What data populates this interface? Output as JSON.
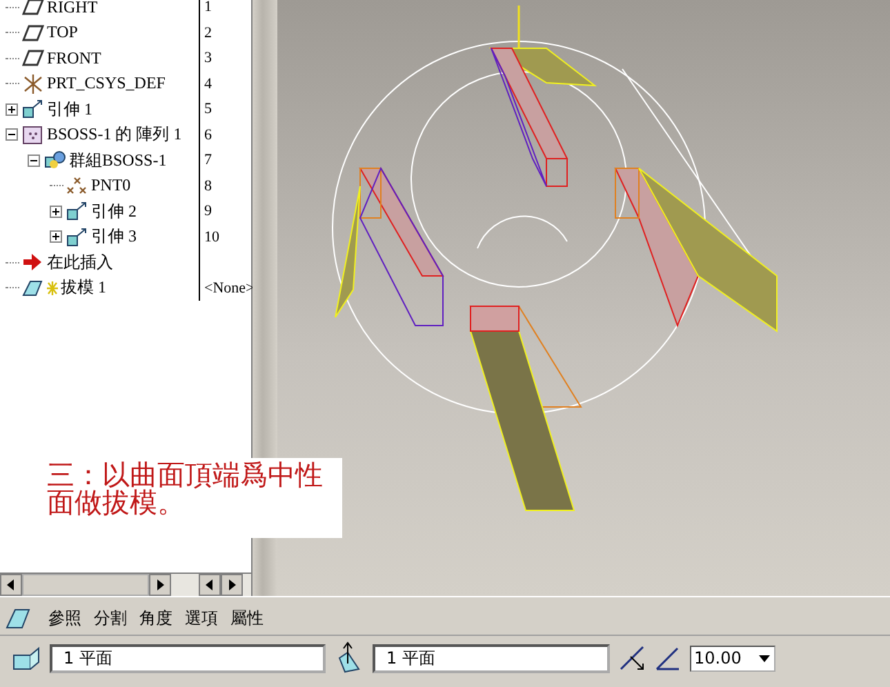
{
  "model_tree": [
    {
      "kind": "datum-plane",
      "label": "RIGHT",
      "number": "1"
    },
    {
      "kind": "datum-plane",
      "label": "TOP",
      "number": "2"
    },
    {
      "kind": "datum-plane",
      "label": "FRONT",
      "number": "3"
    },
    {
      "kind": "csys",
      "label": "PRT_CSYS_DEF",
      "number": "4"
    },
    {
      "kind": "extrude",
      "label": "引伸 1",
      "number": "5",
      "expanded": false
    },
    {
      "kind": "pattern",
      "label": "BSOSS-1 的 陣列 1",
      "number": "6",
      "expanded": true,
      "children": [
        {
          "kind": "group",
          "label": "群組BSOSS-1",
          "number": "7",
          "expanded": true,
          "children": [
            {
              "kind": "point",
              "label": "PNT0",
              "number": "8"
            },
            {
              "kind": "extrude",
              "label": "引伸 2",
              "number": "9",
              "expanded": false
            },
            {
              "kind": "extrude",
              "label": "引伸 3",
              "number": "10",
              "expanded": false
            }
          ]
        }
      ]
    },
    {
      "kind": "insert",
      "label": "在此插入"
    },
    {
      "kind": "draft",
      "label": "拔模 1",
      "number": "<None>"
    }
  ],
  "note": "三：以曲面頂端爲中性面做拔模。",
  "dashboard": {
    "tabs": [
      "參照",
      "分割",
      "角度",
      "選項",
      "屬性"
    ],
    "hinge_field": {
      "value": "1 平面"
    },
    "pull_direction_field": {
      "value": "1 平面"
    },
    "angle_field": {
      "value": "10.00"
    }
  }
}
